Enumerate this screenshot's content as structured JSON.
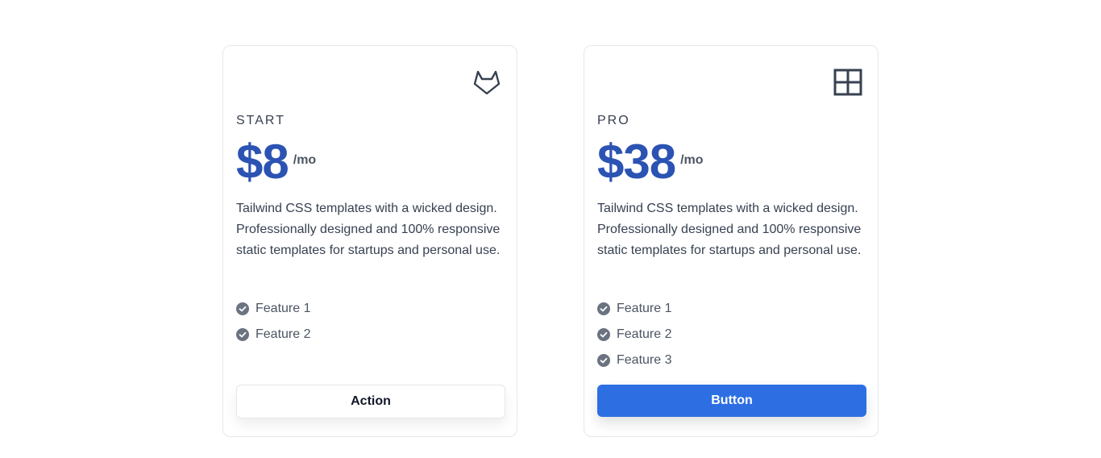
{
  "plans": [
    {
      "icon": "gitlab-icon",
      "tier": "START",
      "price": "$8",
      "period": "/mo",
      "description": "Tailwind CSS templates with a wicked design. Professionally designed and 100% responsive static templates for startups and personal use.",
      "features": [
        "Feature 1",
        "Feature 2"
      ],
      "button_label": "Action"
    },
    {
      "icon": "grid-icon",
      "tier": "PRO",
      "price": "$38",
      "period": "/mo",
      "description": "Tailwind CSS templates with a wicked design. Professionally designed and 100% responsive static templates for startups and personal use.",
      "features": [
        "Feature 1",
        "Feature 2",
        "Feature 3"
      ],
      "button_label": "Button"
    }
  ],
  "colors": {
    "price": "#2b53b3",
    "primary_button": "#2d6fe3",
    "check": "#6b7280",
    "border": "#e5e7eb"
  }
}
